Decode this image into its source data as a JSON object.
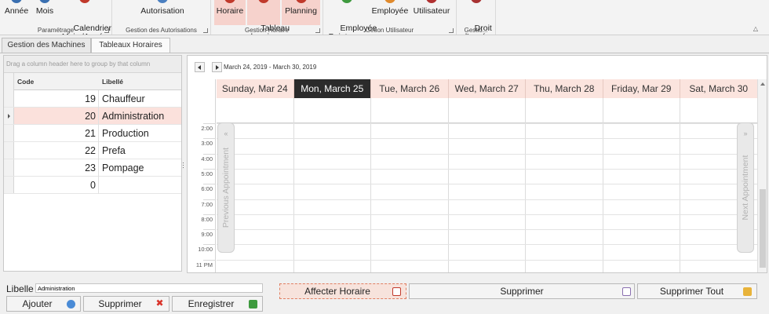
{
  "ribbon": {
    "groups": [
      {
        "label": "Paramétrage",
        "buttons": [
          "Année",
          "Mois",
          "Calendrier\nMois /Année"
        ]
      },
      {
        "label": "Gestion des Autorisations",
        "buttons": [
          "Autorisation"
        ]
      },
      {
        "label": "Gestion Horaire",
        "buttons": [
          "Horaire",
          "Tableau\nhoraire",
          "Planning"
        ]
      },
      {
        "label": "Getion Utilisateur",
        "buttons": [
          "Employée\nPointeuse",
          "Employée",
          "Utilisateur"
        ]
      },
      {
        "label": "Gestio...",
        "buttons": [
          "Droit\nd'accés"
        ]
      }
    ]
  },
  "tabs": [
    "Gestion des Machines",
    "Tableaux Horaires"
  ],
  "grid": {
    "group_hint": "Drag a column header here to group by that column",
    "columns": [
      "Code",
      "Libellé"
    ],
    "rows": [
      {
        "code": "19",
        "libelle": "Chauffeur"
      },
      {
        "code": "20",
        "libelle": "Administration"
      },
      {
        "code": "21",
        "libelle": "Production"
      },
      {
        "code": "22",
        "libelle": "Prefa"
      },
      {
        "code": "23",
        "libelle": "Pompage"
      },
      {
        "code": "0",
        "libelle": ""
      }
    ],
    "selected_index": 1
  },
  "scheduler": {
    "range": "March 24, 2019 - March 30, 2019",
    "days": [
      "Sunday, Mar 24",
      "Mon, March 25",
      "Tue, March 26",
      "Wed, March 27",
      "Thu, March 28",
      "Friday, Mar 29",
      "Sat, March 30"
    ],
    "today_index": 1,
    "times": [
      "2:00",
      "3:00",
      "4:00",
      "5:00",
      "6:00",
      "7:00",
      "8:00",
      "9:00",
      "10:00",
      "11 PM"
    ],
    "prev_label": "Previous Appointment",
    "next_label": "Next Appointment"
  },
  "bottom": {
    "libelle_label": "Libelle",
    "libelle_value": "Administration",
    "ajouter": "Ajouter",
    "supprimer_left": "Supprimer",
    "enregistrer": "Enregistrer",
    "affecter": "Affecter Horaire",
    "supprimer": "Supprimer",
    "supprimer_tout": "Supprimer Tout"
  },
  "colors": {
    "accent": "#f6d2cc",
    "today": "#2b2b2b",
    "day_header": "#fbe4de",
    "selected_row": "#fbe1dc"
  }
}
